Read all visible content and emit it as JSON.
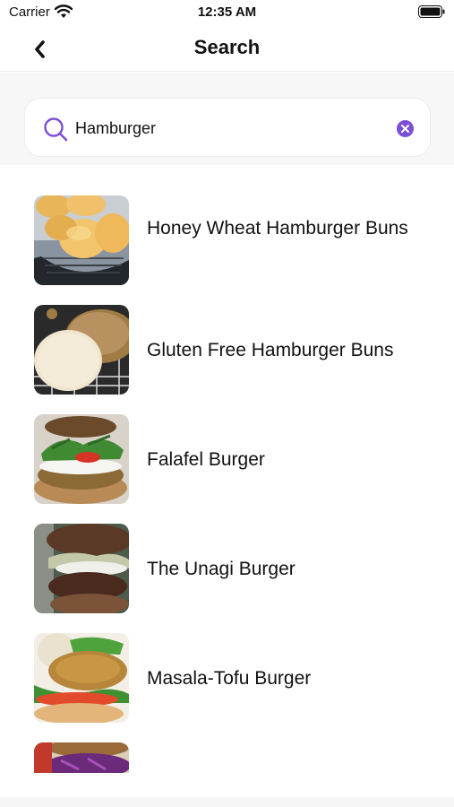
{
  "status_bar": {
    "carrier": "Carrier",
    "time": "12:35 AM"
  },
  "nav": {
    "title": "Search",
    "back_icon": "chevron-left-icon"
  },
  "search": {
    "query": "Hamburger",
    "search_icon": "search-icon",
    "clear_icon": "clear-circle-icon",
    "accent_color": "#7b4fd6"
  },
  "results": [
    {
      "title": "Honey Wheat Hamburger Buns",
      "thumb": "buns-in-basket"
    },
    {
      "title": "Gluten Free Hamburger Buns",
      "thumb": "sliced-bun"
    },
    {
      "title": "Falafel Burger",
      "thumb": "falafel-burger"
    },
    {
      "title": "The Unagi Burger",
      "thumb": "unagi-burger"
    },
    {
      "title": "Masala-Tofu Burger",
      "thumb": "tofu-burger"
    },
    {
      "title": "",
      "thumb": "cabbage-burger"
    }
  ]
}
